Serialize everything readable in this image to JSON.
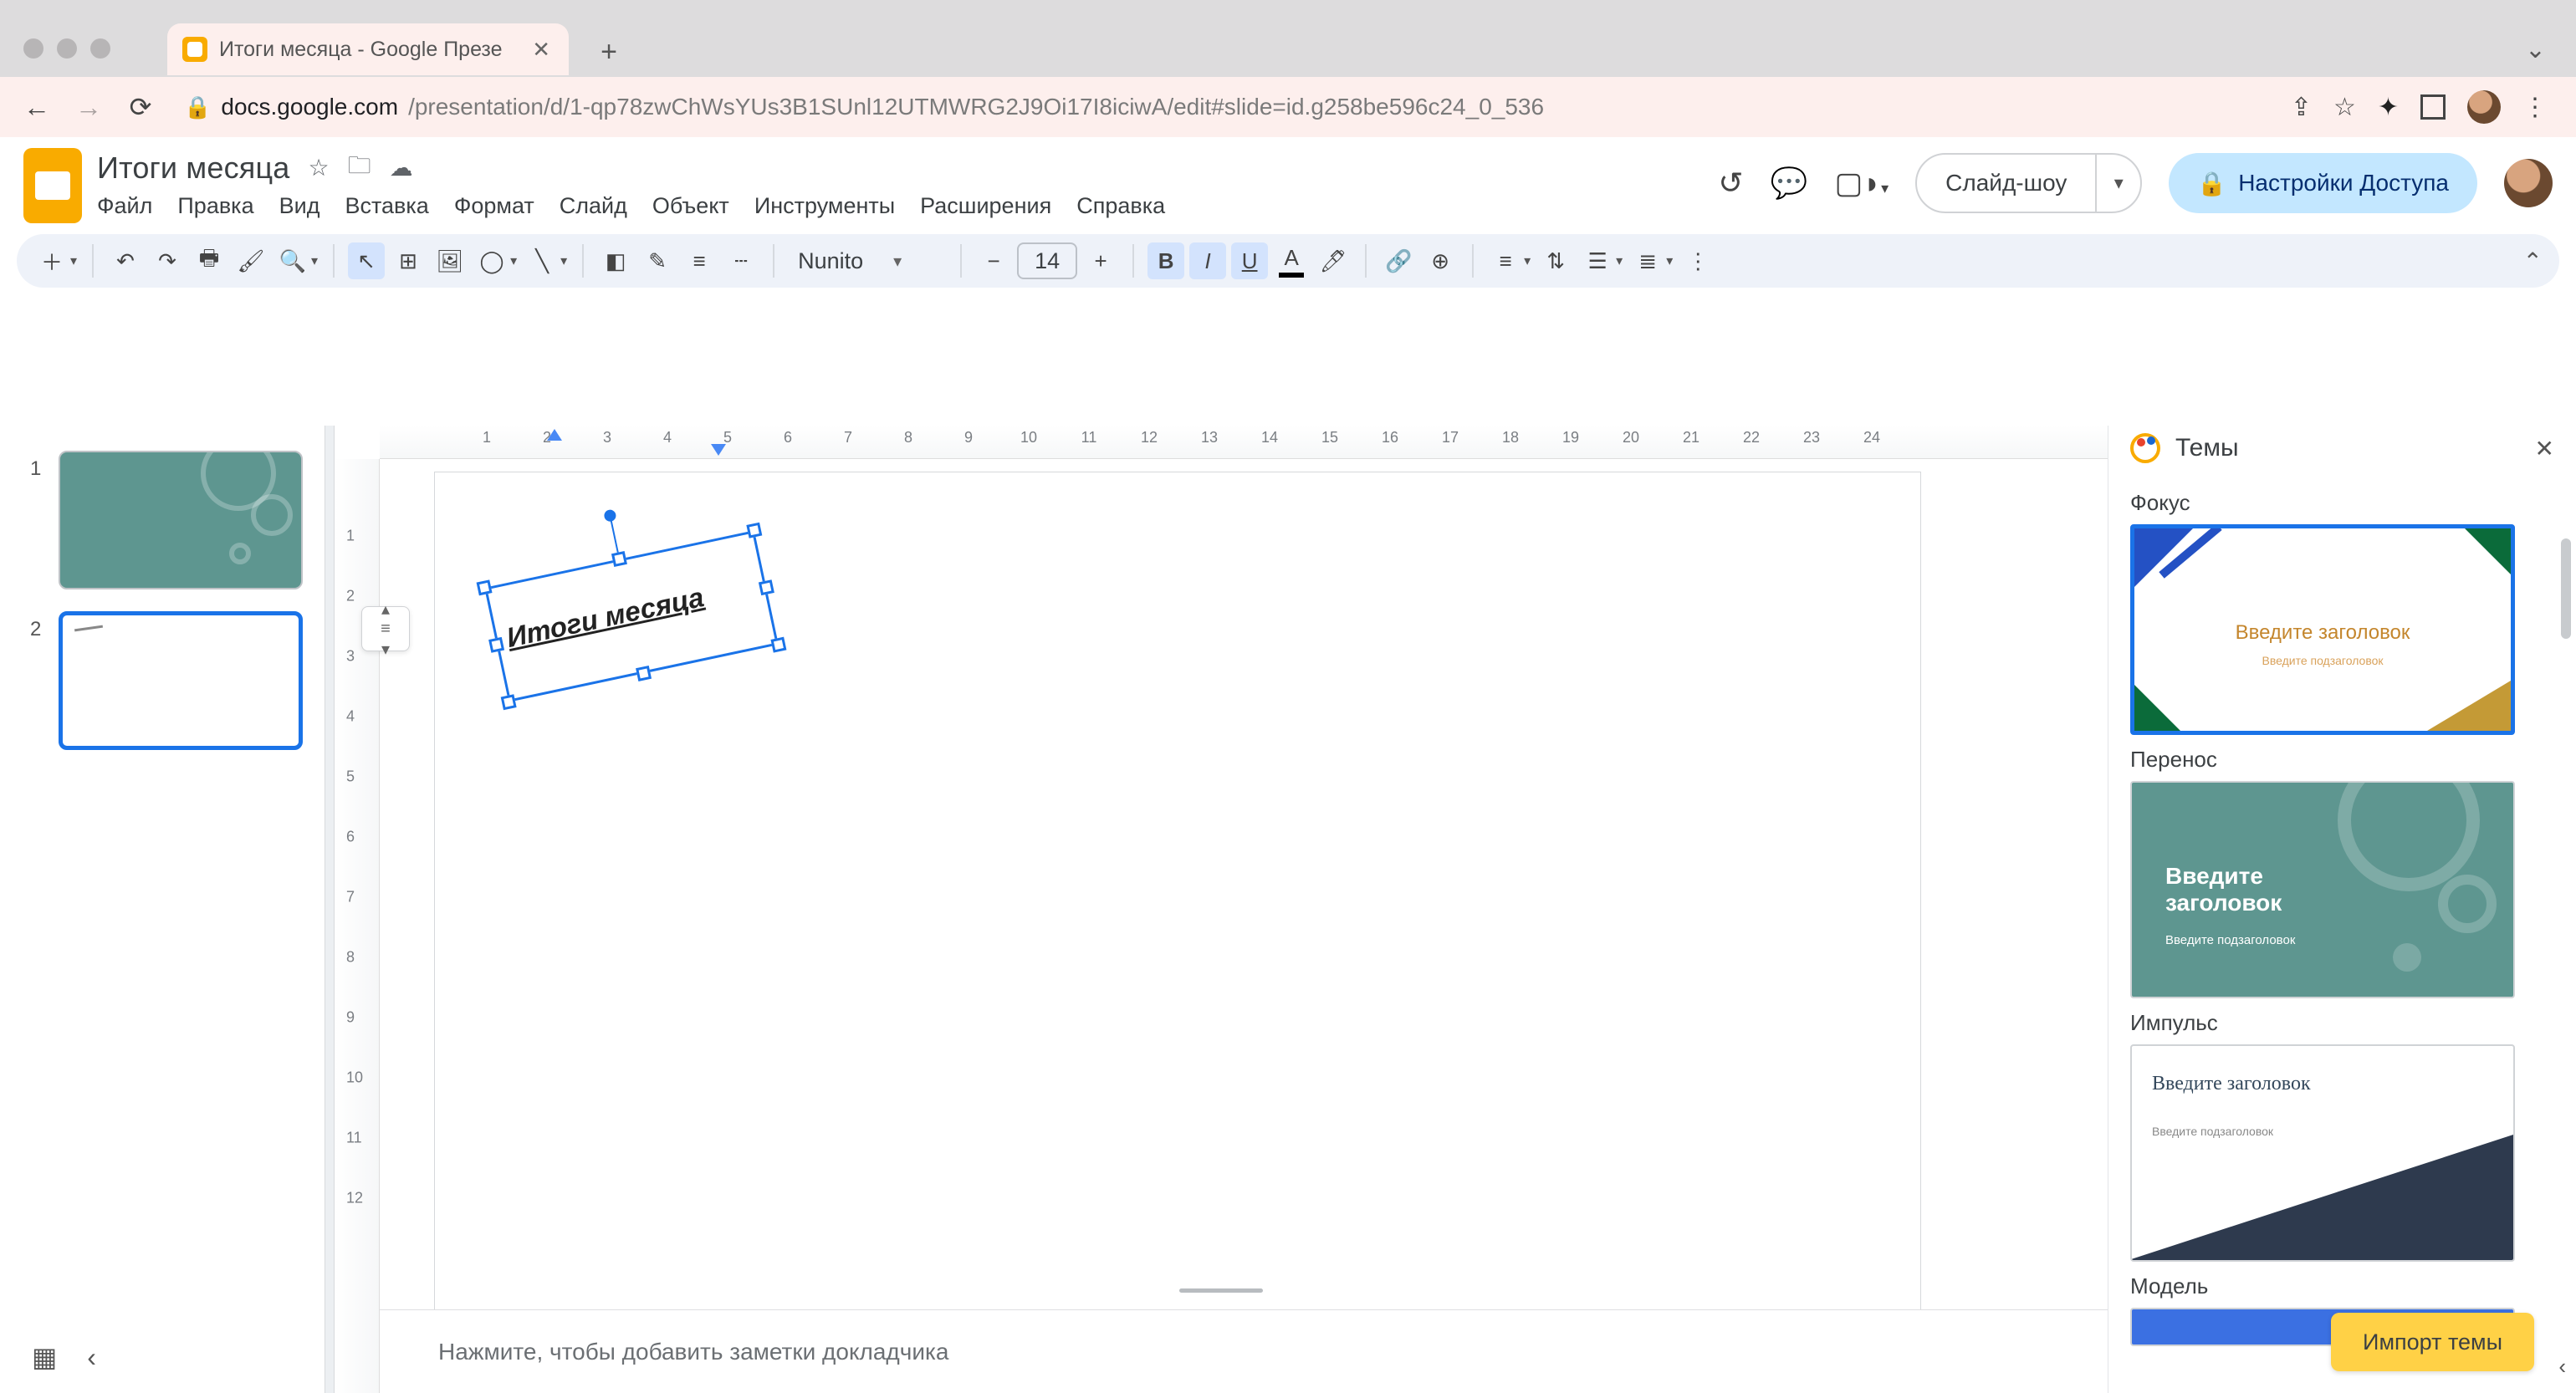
{
  "browser": {
    "tab_title": "Итоги месяца - Google Презе",
    "url_host": "docs.google.com",
    "url_path": "/presentation/d/1-qp78zwChWsYUs3B1SUnl12UTMWRG2J9Oi17I8iciwA/edit#slide=id.g258be596c24_0_536"
  },
  "header": {
    "doc_title": "Итоги месяца",
    "menu": [
      "Файл",
      "Правка",
      "Вид",
      "Вставка",
      "Формат",
      "Слайд",
      "Объект",
      "Инструменты",
      "Расширения",
      "Справка"
    ],
    "slideshow_label": "Слайд-шоу",
    "share_label": "Настройки Доступа"
  },
  "toolbar": {
    "font_name": "Nunito",
    "font_size": "14"
  },
  "filmstrip": {
    "slides": [
      {
        "num": "1"
      },
      {
        "num": "2"
      }
    ]
  },
  "canvas": {
    "textbox_text": "Итоги месяца",
    "ruler_h": [
      "1",
      "2",
      "3",
      "4",
      "5",
      "6",
      "7",
      "8",
      "9",
      "10",
      "11",
      "12",
      "13",
      "14",
      "15",
      "16",
      "17",
      "18",
      "19",
      "20",
      "21",
      "22",
      "23",
      "24"
    ],
    "ruler_v": [
      "1",
      "2",
      "3",
      "4",
      "5",
      "6",
      "7",
      "8",
      "9",
      "10",
      "11",
      "12"
    ]
  },
  "notes": {
    "placeholder": "Нажмите, чтобы добавить заметки докладчика"
  },
  "themes": {
    "title": "Темы",
    "items": [
      {
        "label": "Фокус",
        "title": "Введите заголовок",
        "subtitle": "Введите подзаголовок"
      },
      {
        "label": "Перенос",
        "title": "Введите заголовок",
        "subtitle": "Введите подзаголовок"
      },
      {
        "label": "Импульс",
        "title": "Введите заголовок",
        "subtitle": "Введите подзаголовок"
      },
      {
        "label": "Модель"
      }
    ],
    "import_label": "Импорт темы"
  }
}
